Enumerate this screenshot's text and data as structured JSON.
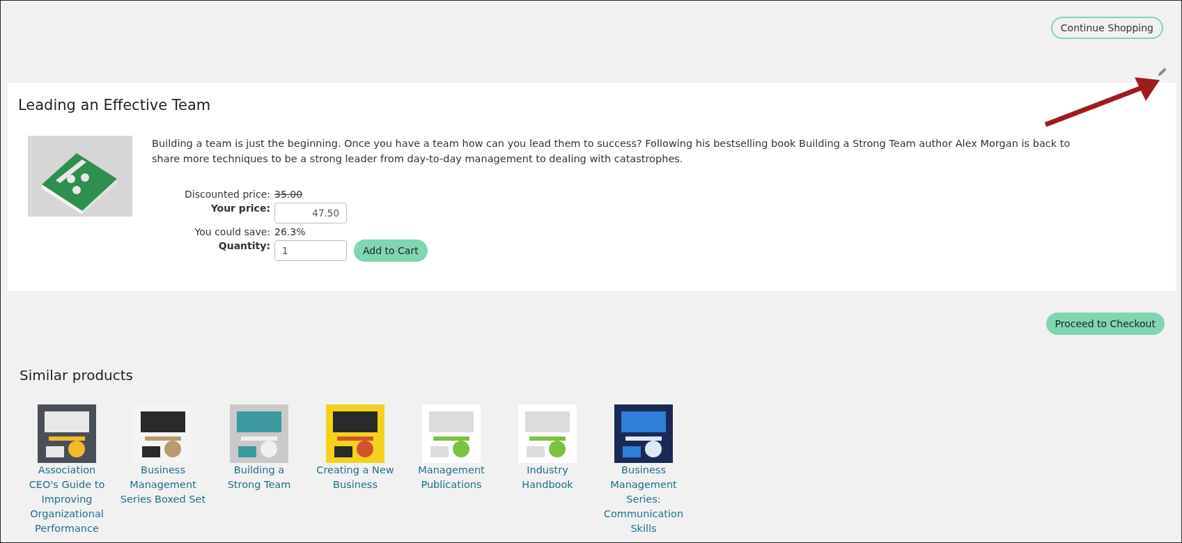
{
  "continue_button": "Continue Shopping",
  "product": {
    "title": "Leading an Effective Team",
    "description": "Building a team is just the beginning. Once you have a team how can you lead them to success? Following his bestselling book Building a Strong Team author Alex Morgan is back to share more techniques to be a strong leader from day-to-day management to dealing with catastrophes.",
    "price_rows": [
      {
        "kind": "text",
        "label": "Discounted price:",
        "value": "35.00",
        "strikethrough": true
      },
      {
        "kind": "input",
        "label": "Your price:",
        "value": "47.50"
      },
      {
        "kind": "text",
        "label": "You could save:",
        "value": "26.3%",
        "strikethrough": false
      },
      {
        "kind": "input",
        "label": "Quantity:",
        "value": "1",
        "button": "Add to Cart"
      }
    ]
  },
  "checkout_button": "Proceed to Checkout",
  "similar": {
    "heading": "Similar products",
    "items": [
      {
        "title": "Association CEO's Guide to Improving Organizational Performance"
      },
      {
        "title": "Business Management Series Boxed Set"
      },
      {
        "title": "Building a Strong Team"
      },
      {
        "title": "Creating a New Business"
      },
      {
        "title": "Management Publications"
      },
      {
        "title": "Industry Handbook"
      },
      {
        "title": "Business Management Series: Communication Skills"
      }
    ]
  }
}
